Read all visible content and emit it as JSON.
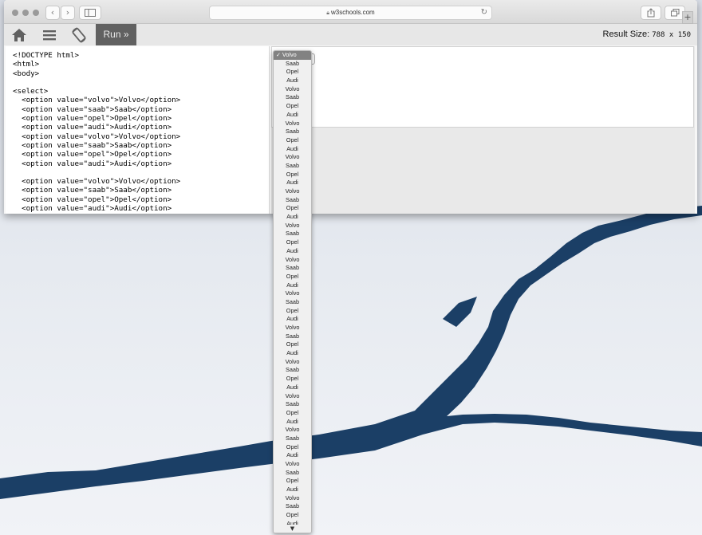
{
  "browser": {
    "url": "w3schools.com",
    "nav_back": "‹",
    "nav_forward": "›",
    "new_tab": "+"
  },
  "toolbar": {
    "run_label": "Run »",
    "result_size_label": "Result Size:",
    "result_size_value": "788 x 150"
  },
  "code_lines": [
    "<!DOCTYPE html>",
    "<html>",
    "<body>",
    "",
    "<select>",
    "  <option value=\"volvo\">Volvo</option>",
    "  <option value=\"saab\">Saab</option>",
    "  <option value=\"opel\">Opel</option>",
    "  <option value=\"audi\">Audi</option>",
    "  <option value=\"volvo\">Volvo</option>",
    "  <option value=\"saab\">Saab</option>",
    "  <option value=\"opel\">Opel</option>",
    "  <option value=\"audi\">Audi</option>",
    "",
    "  <option value=\"volvo\">Volvo</option>",
    "  <option value=\"saab\">Saab</option>",
    "  <option value=\"opel\">Opel</option>",
    "  <option value=\"audi\">Audi</option>"
  ],
  "dropdown": {
    "checkmark": "✓",
    "options": [
      "Volvo",
      "Saab",
      "Opel",
      "Audi",
      "Volvo",
      "Saab",
      "Opel",
      "Audi",
      "Volvo",
      "Saab",
      "Opel",
      "Audi",
      "Volvo",
      "Saab",
      "Opel",
      "Audi",
      "Volvo",
      "Saab",
      "Opel",
      "Audi",
      "Volvo",
      "Saab",
      "Opel",
      "Audi",
      "Volvo",
      "Saab",
      "Opel",
      "Audi",
      "Volvo",
      "Saab",
      "Opel",
      "Audi",
      "Volvo",
      "Saab",
      "Opel",
      "Audi",
      "Volvo",
      "Saab",
      "Opel",
      "Audi",
      "Volvo",
      "Saab",
      "Opel",
      "Audi",
      "Volvo",
      "Saab",
      "Opel",
      "Audi",
      "Volvo",
      "Saab",
      "Opel",
      "Audi",
      "Volvo",
      "Saab",
      "Opel",
      "Audi"
    ],
    "selected_index": 0,
    "scroll_arrow": "▼"
  },
  "colors": {
    "water": "#1b3f66",
    "snow": "#e8ecf2",
    "run_button": "#616161",
    "selected_option": "#828282"
  }
}
